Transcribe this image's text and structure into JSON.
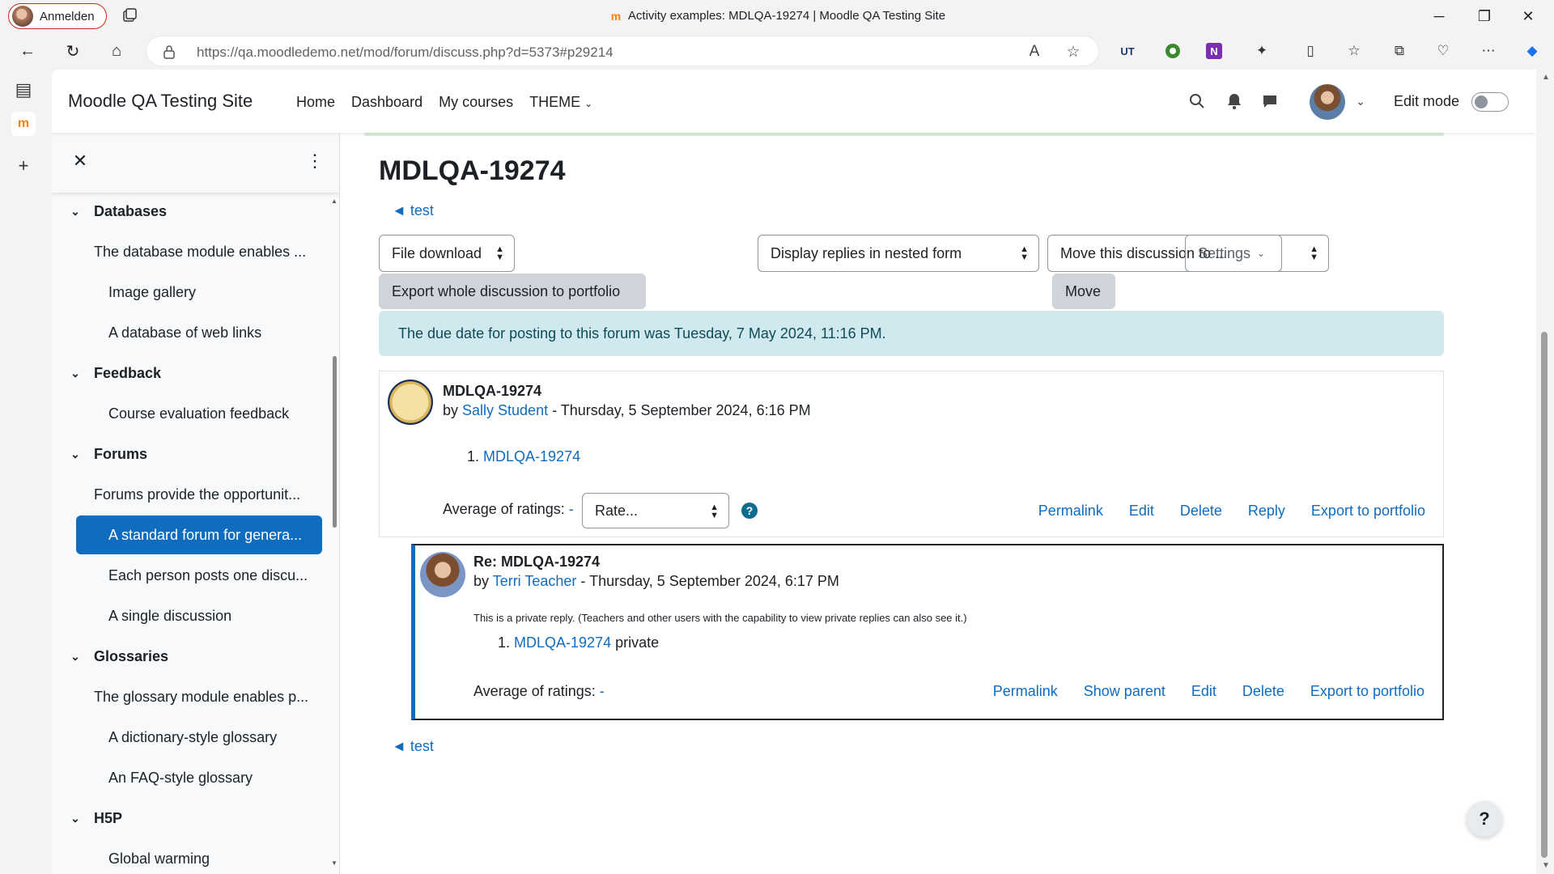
{
  "browser": {
    "profile_label": "Anmelden",
    "window_title": "Activity examples: MDLQA-19274 | Moodle QA Testing Site",
    "url": "https://qa.moodledemo.net/mod/forum/discuss.php?d=5373#p29214",
    "ext_ut": "UT",
    "ext_onenote": "N"
  },
  "header": {
    "site_name": "Moodle QA Testing Site",
    "nav": [
      "Home",
      "Dashboard",
      "My courses",
      "THEME"
    ],
    "edit_mode": "Edit mode"
  },
  "drawer": {
    "items": [
      {
        "kind": "section",
        "label": "Databases"
      },
      {
        "kind": "desc",
        "label": "The database module enables ..."
      },
      {
        "kind": "activity",
        "label": "Image gallery"
      },
      {
        "kind": "activity",
        "label": "A database of web links"
      },
      {
        "kind": "section",
        "label": "Feedback"
      },
      {
        "kind": "activity",
        "label": "Course evaluation feedback"
      },
      {
        "kind": "section",
        "label": "Forums"
      },
      {
        "kind": "desc",
        "label": "Forums provide the opportunit..."
      },
      {
        "kind": "active",
        "label": "A standard forum for genera..."
      },
      {
        "kind": "activity",
        "label": "Each person posts one discu..."
      },
      {
        "kind": "activity",
        "label": "A single discussion"
      },
      {
        "kind": "section",
        "label": "Glossaries"
      },
      {
        "kind": "desc",
        "label": "The glossary module enables p..."
      },
      {
        "kind": "activity",
        "label": "A dictionary-style glossary"
      },
      {
        "kind": "activity",
        "label": "An FAQ-style glossary"
      },
      {
        "kind": "section",
        "label": "H5P"
      },
      {
        "kind": "activity",
        "label": "Global warming"
      }
    ]
  },
  "main": {
    "title": "MDLQA-19274",
    "back_link": "◄ test",
    "file_download": "File download",
    "display_mode": "Display replies in nested form",
    "move_select": "Move this discussion to ...",
    "settings": "Settings",
    "export_whole": "Export whole discussion to portfolio",
    "move_button": "Move",
    "alert": "The due date for posting to this forum was Tuesday, 7 May 2024, 11:16 PM."
  },
  "posts": [
    {
      "title": "MDLQA-19274",
      "by_prefix": "by ",
      "author": "Sally Student",
      "date": " - Thursday, 5 September 2024, 6:16 PM",
      "list_num": "1.",
      "list_link": "MDLQA-19274",
      "list_suffix": "",
      "note": "",
      "ratings_label": "Average of ratings: ",
      "ratings_value": "-",
      "rate_select": "Rate...",
      "help": "?",
      "actions": [
        "Permalink",
        "Edit",
        "Delete",
        "Reply",
        "Export to portfolio"
      ]
    },
    {
      "title": "Re: MDLQA-19274",
      "by_prefix": "by ",
      "author": "Terri Teacher",
      "date": " - Thursday, 5 September 2024, 6:17 PM",
      "note": "This is a private reply. (Teachers and other users with the capability to view private replies can also see it.)",
      "list_num": "1.",
      "list_link": "MDLQA-19274",
      "list_suffix": " private",
      "ratings_label": "Average of ratings: ",
      "ratings_value": "-",
      "actions": [
        "Permalink",
        "Show parent",
        "Edit",
        "Delete",
        "Export to portfolio"
      ]
    }
  ],
  "floating_help": "?",
  "colors": {
    "link": "#0f6cbf",
    "active_bg": "#0f6cbf",
    "alert_bg": "#cfe9ee",
    "moodle_orange": "#f98012"
  }
}
